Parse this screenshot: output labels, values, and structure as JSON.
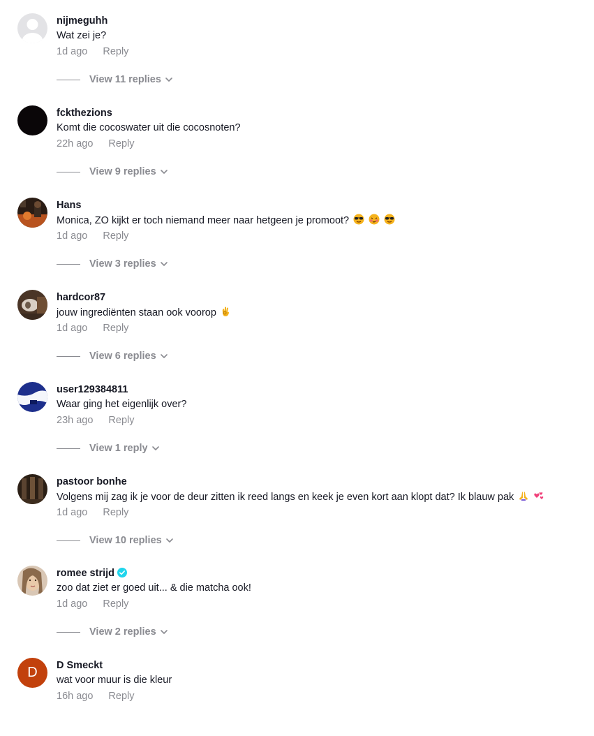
{
  "comments": [
    {
      "username": "nijmeguhh",
      "text": "Wat zei je?",
      "time": "1d ago",
      "reply": "Reply",
      "view_replies": "View 11 replies",
      "avatar": "default-gray"
    },
    {
      "username": "fckthezions",
      "text": "Komt die cocoswater uit die cocosnoten?",
      "time": "22h ago",
      "reply": "Reply",
      "view_replies": "View 9 replies",
      "avatar": "black"
    },
    {
      "username": "Hans",
      "text": "Monica, ZO kijkt er toch niemand meer naar hetgeen je promoot?",
      "emojis": [
        "sunglasses-emoji",
        "drunk-face-emoji",
        "sunglasses-emoji"
      ],
      "time": "1d ago",
      "reply": "Reply",
      "view_replies": "View 3 replies",
      "avatar": "photo-dark-orange"
    },
    {
      "username": "hardcor87",
      "text": "jouw ingrediënten staan ook voorop",
      "emojis": [
        "ok-hand-emoji"
      ],
      "time": "1d ago",
      "reply": "Reply",
      "view_replies": "View 6 replies",
      "avatar": "photo-brown"
    },
    {
      "username": "user129384811",
      "text": "Waar ging het eigenlijk over?",
      "time": "23h ago",
      "reply": "Reply",
      "view_replies": "View 1 reply",
      "avatar": "blue-white"
    },
    {
      "username": "pastoor bonhe",
      "text": "Volgens mij zag ik je voor de deur zitten ik reed langs en keek je even kort aan klopt dat? Ik blauw pak",
      "emojis": [
        "folded-hands-emoji",
        "revolving-hearts-emoji"
      ],
      "time": "1d ago",
      "reply": "Reply",
      "view_replies": "View 10 replies",
      "avatar": "photo-dark-brown"
    },
    {
      "username": "romee strijd",
      "verified": true,
      "text": "zoo dat ziet er goed uit... & die matcha ook!",
      "time": "1d ago",
      "reply": "Reply",
      "view_replies": "View 2 replies",
      "avatar": "photo-face"
    },
    {
      "username": "D Smeckt",
      "text": "wat voor muur is die kleur",
      "time": "16h ago",
      "reply": "Reply",
      "avatar": "letter-orange",
      "avatar_letter": "D"
    }
  ],
  "colors": {
    "text": "#161823",
    "secondary": "#8a8b91",
    "verified": "#20d5ec",
    "letter_avatar": "#c2410c"
  }
}
